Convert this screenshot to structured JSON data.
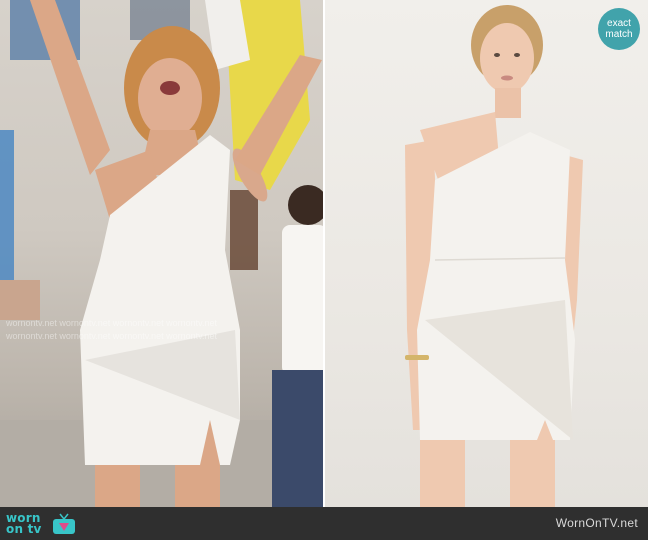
{
  "badge": {
    "line1": "exact",
    "line2": "match"
  },
  "footer": {
    "logo_line1": "worn",
    "logo_line2": "on tv",
    "site": "WornOnTV.net"
  },
  "watermark": {
    "row1": "wornontv.net  wornontv.net  wornontv.net  wornontv.net",
    "row2": "wornontv.net  wornontv.net  wornontv.net  wornontv.net"
  },
  "colors": {
    "brand_teal": "#38c5c8",
    "badge_teal": "#41a3ab",
    "footer_bg": "#2f2f2f",
    "dress_white": "#f4f2ee"
  }
}
